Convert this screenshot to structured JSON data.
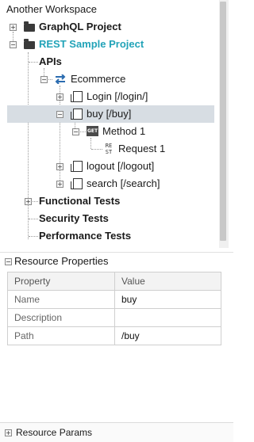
{
  "tree": {
    "workspace": "Another Workspace",
    "projects": [
      {
        "name": "GraphQL Project"
      },
      {
        "name": "REST Sample Project"
      }
    ],
    "apis_label": "APIs",
    "service_label": "Ecommerce",
    "resources": [
      {
        "label": "Login [/login/]"
      },
      {
        "label": "buy [/buy]"
      },
      {
        "label": "logout [/logout]"
      },
      {
        "label": "search [/search]"
      }
    ],
    "method_badge": "GET",
    "method_label": "Method 1",
    "request_badge": "RE ST",
    "request_label": "Request 1",
    "functional_tests": "Functional Tests",
    "security_tests": "Security Tests",
    "performance_tests": "Performance Tests"
  },
  "properties": {
    "title": "Resource Properties",
    "headers": {
      "property": "Property",
      "value": "Value"
    },
    "rows": [
      {
        "key": "Name",
        "value": "buy"
      },
      {
        "key": "Description",
        "value": ""
      },
      {
        "key": "Path",
        "value": "/buy"
      }
    ]
  },
  "params": {
    "title": "Resource Params"
  },
  "colors": {
    "selected_row": "#d7dde3",
    "project_accent": "#22a3b8"
  }
}
